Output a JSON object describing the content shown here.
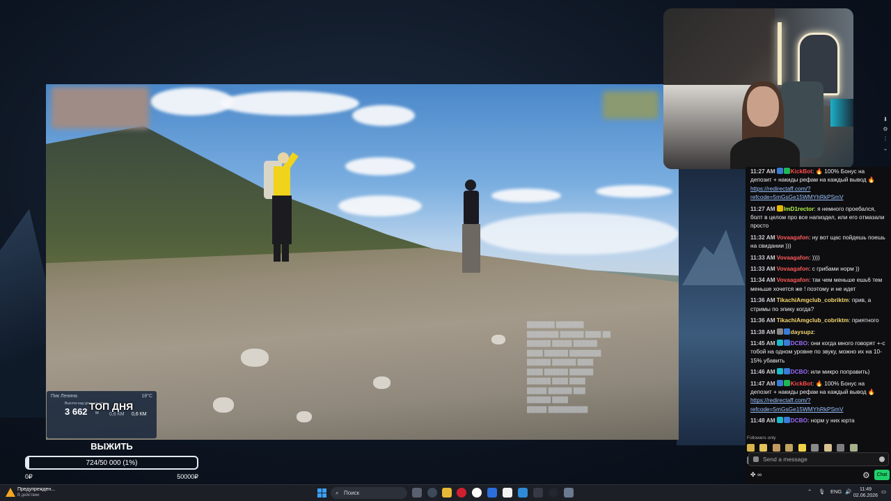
{
  "video": {
    "overlay_card": {
      "location": "Пик Ленина",
      "sub": "Высота над уровнем моря",
      "altitude": "3 662",
      "unit": "м",
      "dist1": "0,6 КМ",
      "dist2": "0,6 КМ",
      "temp": "18°C"
    },
    "top_day_label": "ТОП ДНЯ"
  },
  "goal": {
    "title": "ВЫЖИТЬ",
    "progress_text": "724/50 000 (1%)",
    "progress_fraction": 0.0145,
    "min_label": "0₽",
    "max_label": "50000₽"
  },
  "chat": {
    "messages": [
      {
        "time": "11:27 AM",
        "user": "KickBot",
        "color": "#ff4d4d",
        "text": ": 🔥 100% Бонус на депозит + накиды рефам на каждый вывод 🔥 ",
        "link": "https://redirectaff.com/?refcode=5mGsGe15WMYhRkPSmV",
        "badges": [
          "#3a7bd5",
          "#1db954"
        ]
      },
      {
        "time": "11:27 AM",
        "user": "ImD1rector",
        "color": "#b5f54a",
        "text": ": я немного проебался, болт в целом про все напиздел, или его отмазали просто",
        "link": "",
        "badges": [
          "#e6b800"
        ]
      },
      {
        "time": "11:32 AM",
        "user": "Vovaagafon",
        "color": "#ff5a5a",
        "text": ": ну вот щас пойдешь поешь на свидании )))",
        "link": "",
        "badges": []
      },
      {
        "time": "11:33 AM",
        "user": "Vovaagafon",
        "color": "#ff5a5a",
        "text": ": ))))",
        "link": "",
        "badges": []
      },
      {
        "time": "11:33 AM",
        "user": "Vovaagafon",
        "color": "#ff5a5a",
        "text": ": с грибами норм ))",
        "link": "",
        "badges": []
      },
      {
        "time": "11:34 AM",
        "user": "Vovaagafon",
        "color": "#ff5a5a",
        "text": ": так чем меньше ешь6 тем меньше хочется же ! поэтому и не идет",
        "link": "",
        "badges": []
      },
      {
        "time": "11:36 AM",
        "user": "TikachiAmgclub_cobriktm",
        "color": "#f5d76e",
        "text": ": прив, а стримы по эпику когда?",
        "link": "",
        "badges": []
      },
      {
        "time": "11:36 AM",
        "user": "TikachiAmgclub_cobriktm",
        "color": "#f5d76e",
        "text": ": приятного",
        "link": "",
        "badges": []
      },
      {
        "time": "11:38 AM",
        "user": "daysupz",
        "color": "#f5d76e",
        "text": ": ",
        "link": "",
        "badges": [
          "#888888",
          "#3a7bd5"
        ]
      },
      {
        "time": "11:45 AM",
        "user": "DCBO",
        "color": "#9b6bff",
        "text": ": они когда много говорят +-с тобой на одном уровне по звуку, можно их на 10-15% убавить",
        "link": "",
        "badges": [
          "#1db9c9",
          "#3a7bd5"
        ]
      },
      {
        "time": "11:46 AM",
        "user": "DCBO",
        "color": "#9b6bff",
        "text": ": или микро поправить)",
        "link": "",
        "badges": [
          "#1db9c9",
          "#3a7bd5"
        ]
      },
      {
        "time": "11:47 AM",
        "user": "KickBot",
        "color": "#ff4d4d",
        "text": ": 🔥 100% Бонус на депозит + накиды рефам на каждый вывод 🔥 ",
        "link": "https://redirectaff.com/?refcode=5mGsGe15WMYhRkPSmV",
        "badges": [
          "#3a7bd5",
          "#1db954"
        ]
      },
      {
        "time": "11:48 AM",
        "user": "DCBO",
        "color": "#9b6bff",
        "text": ": норм у них юрта",
        "link": "",
        "badges": [
          "#1db9c9",
          "#3a7bd5"
        ]
      }
    ],
    "followers_only": "Followers only",
    "input_placeholder": "Send a message",
    "points": "∞",
    "chat_button": "Chat"
  },
  "taskbar": {
    "notification_title": "Предупрежден...",
    "notification_sub": "В действии",
    "search_placeholder": "Поиск",
    "lang": "ENG",
    "time": "11:49",
    "date": "02.06.2026"
  }
}
